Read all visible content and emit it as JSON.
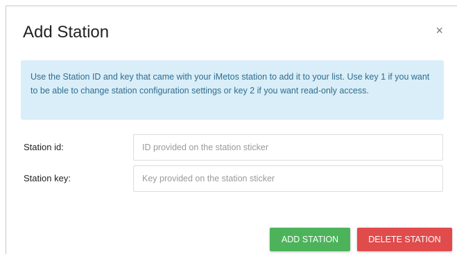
{
  "modal": {
    "title": "Add Station",
    "close_symbol": "×",
    "info_text": "Use the Station ID and key that came with your iMetos station to add it to your list. Use key 1 if you want to be able to change station configuration settings or key 2 if you want read-only access."
  },
  "form": {
    "station_id": {
      "label": "Station id:",
      "value": "",
      "placeholder": "ID provided on the station sticker"
    },
    "station_key": {
      "label": "Station key:",
      "value": "",
      "placeholder": "Key provided on the station sticker"
    }
  },
  "buttons": {
    "add_label": "ADD STATION",
    "delete_label": "DELETE STATION"
  },
  "colors": {
    "info_bg": "#d9eef8",
    "info_text": "#2f6d8e",
    "add_button": "#4db35b",
    "delete_button": "#e04b4b"
  },
  "icons": {
    "close": "close-icon"
  }
}
